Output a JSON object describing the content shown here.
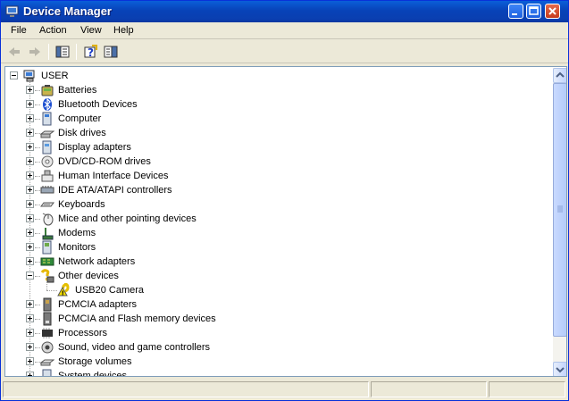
{
  "window": {
    "title": "Device Manager"
  },
  "menu": {
    "items": [
      "File",
      "Action",
      "View",
      "Help"
    ]
  },
  "toolbar": {
    "buttons": [
      "back",
      "forward",
      "show-hide-console-tree",
      "help",
      "properties"
    ]
  },
  "tree": {
    "root": {
      "label": "USER",
      "expanded": true
    },
    "items": [
      {
        "label": "Batteries",
        "icon": "battery-icon",
        "expanded": false
      },
      {
        "label": "Bluetooth Devices",
        "icon": "bluetooth-icon",
        "expanded": false
      },
      {
        "label": "Computer",
        "icon": "computer-icon",
        "expanded": false
      },
      {
        "label": "Disk drives",
        "icon": "disk-drive-icon",
        "expanded": false
      },
      {
        "label": "Display adapters",
        "icon": "display-adapter-icon",
        "expanded": false
      },
      {
        "label": "DVD/CD-ROM drives",
        "icon": "dvd-drive-icon",
        "expanded": false
      },
      {
        "label": "Human Interface Devices",
        "icon": "hid-icon",
        "expanded": false
      },
      {
        "label": "IDE ATA/ATAPI controllers",
        "icon": "ide-controller-icon",
        "expanded": false
      },
      {
        "label": "Keyboards",
        "icon": "keyboard-icon",
        "expanded": false
      },
      {
        "label": "Mice and other pointing devices",
        "icon": "mouse-icon",
        "expanded": false
      },
      {
        "label": "Modems",
        "icon": "modem-icon",
        "expanded": false
      },
      {
        "label": "Monitors",
        "icon": "monitor-icon",
        "expanded": false
      },
      {
        "label": "Network adapters",
        "icon": "network-adapter-icon",
        "expanded": false
      },
      {
        "label": "Other devices",
        "icon": "unknown-device-icon",
        "expanded": true,
        "children": [
          {
            "label": "USB20 Camera",
            "icon": "warning-device-icon"
          }
        ]
      },
      {
        "label": "PCMCIA adapters",
        "icon": "pcmcia-icon",
        "expanded": false
      },
      {
        "label": "PCMCIA and Flash memory devices",
        "icon": "flash-memory-icon",
        "expanded": false
      },
      {
        "label": "Processors",
        "icon": "processor-icon",
        "expanded": false
      },
      {
        "label": "Sound, video and game controllers",
        "icon": "sound-icon",
        "expanded": false
      },
      {
        "label": "Storage volumes",
        "icon": "storage-volume-icon",
        "expanded": false
      },
      {
        "label": "System devices",
        "icon": "system-device-icon",
        "expanded": false
      }
    ]
  },
  "colors": {
    "titlebar": "#0842b8",
    "chrome": "#ece9d8",
    "pane_border": "#7f9db9",
    "scrollbar": "#c2d3fc"
  }
}
